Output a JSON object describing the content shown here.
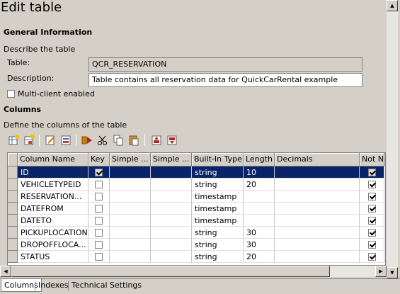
{
  "page_title": "Edit table",
  "general": {
    "heading": "General Information",
    "describe": "Describe the table",
    "table_label": "Table:",
    "table_value": "QCR_RESERVATION",
    "description_label": "Description:",
    "description_value": "Table contains all reservation data for QuickCarRental example",
    "multi_client_label": "Multi-client enabled",
    "multi_client_checked": false
  },
  "columns_section": {
    "heading": "Columns",
    "describe": "Define the columns of the table"
  },
  "toolbar": {
    "icons": [
      "new-column-icon",
      "new-column-from-template-icon",
      "edit-icon",
      "properties-icon",
      "check-icon",
      "cut-icon",
      "copy-icon",
      "paste-icon",
      "move-up-icon",
      "move-down-icon"
    ]
  },
  "grid": {
    "headers": [
      "Column Name",
      "Key",
      "Simple ...",
      "Simple ...",
      "Built-In Type",
      "Length",
      "Decimals",
      "Not N"
    ],
    "rows": [
      {
        "name": "ID",
        "key": true,
        "type": "string",
        "length": "10",
        "decimals": "",
        "not_null": true
      },
      {
        "name": "VEHICLETYPEID",
        "key": false,
        "type": "string",
        "length": "20",
        "decimals": "",
        "not_null": true
      },
      {
        "name": "RESERVATION...",
        "key": false,
        "type": "timestamp",
        "length": "",
        "decimals": "",
        "not_null": true
      },
      {
        "name": "DATEFROM",
        "key": false,
        "type": "timestamp",
        "length": "",
        "decimals": "",
        "not_null": true
      },
      {
        "name": "DATETO",
        "key": false,
        "type": "timestamp",
        "length": "",
        "decimals": "",
        "not_null": true
      },
      {
        "name": "PICKUPLOCATION",
        "key": false,
        "type": "string",
        "length": "30",
        "decimals": "",
        "not_null": true
      },
      {
        "name": "DROPOFFLOCA...",
        "key": false,
        "type": "string",
        "length": "30",
        "decimals": "",
        "not_null": true
      },
      {
        "name": "STATUS",
        "key": false,
        "type": "string",
        "length": "20",
        "decimals": "",
        "not_null": true
      }
    ],
    "selected_row": 0
  },
  "tabs": [
    {
      "label": "Columns",
      "active": true
    },
    {
      "label": "Indexes",
      "active": false
    },
    {
      "label": "Technical Settings",
      "active": false
    }
  ]
}
